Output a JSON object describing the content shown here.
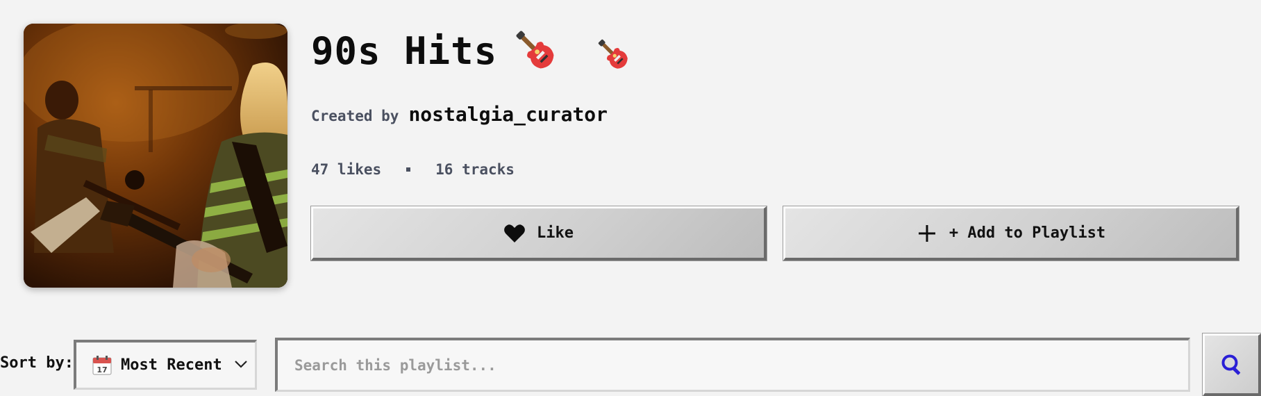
{
  "playlist": {
    "title": "90s Hits",
    "title_icons": [
      "guitar-icon",
      "guitar-icon"
    ],
    "created_by_label": "Created by",
    "creator": "nostalgia_curator",
    "likes_text": "47 likes",
    "tracks_text": "16 tracks",
    "cover_icon": "album-cover"
  },
  "actions": {
    "like_label": "Like",
    "like_icon": "heart-icon",
    "add_label": "+ Add to Playlist",
    "add_icon": "plus-icon"
  },
  "controls": {
    "sort_label": "Sort by:",
    "sort_selected": "Most Recent",
    "sort_icon": "calendar-icon",
    "calendar_day": "17",
    "search_placeholder": "Search this playlist...",
    "search_value": "",
    "search_icon": "search-icon"
  },
  "colors": {
    "background": "#f3f3f3",
    "muted_text": "#4a5060",
    "search_icon": "#2a1fd6"
  }
}
